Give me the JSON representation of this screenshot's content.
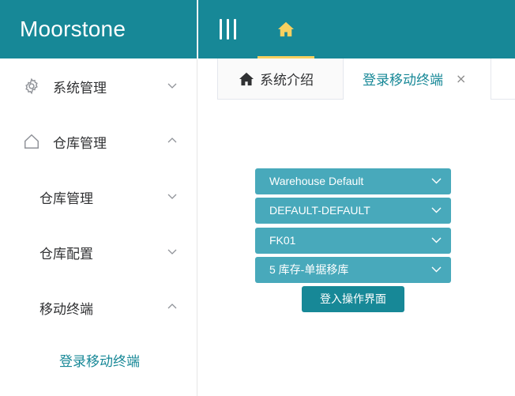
{
  "app": {
    "title": "Moorstone"
  },
  "colors": {
    "primary": "#178897",
    "select_bg": "#48a9bb",
    "home_underline": "#f7d060",
    "text": "#303133"
  },
  "header": {
    "menu_toggle_icon": "hamburger-icon",
    "home_icon": "home-icon"
  },
  "sidebar": {
    "items": [
      {
        "label": "系统管理",
        "icon": "gear-icon",
        "expanded": false
      },
      {
        "label": "仓库管理",
        "icon": "home-outline-icon",
        "expanded": true
      },
      {
        "label": "仓库管理",
        "expanded": false
      },
      {
        "label": "仓库配置",
        "expanded": false
      },
      {
        "label": "移动终端",
        "expanded": true
      },
      {
        "label": "登录移动终端",
        "active": true
      }
    ]
  },
  "tabs": [
    {
      "label": "系统介绍",
      "icon": "home-icon"
    },
    {
      "label": "登录移动终端",
      "active": true,
      "close": "×"
    }
  ],
  "form": {
    "selects": [
      {
        "value": "Warehouse Default"
      },
      {
        "value": "DEFAULT-DEFAULT"
      },
      {
        "value": "FK01"
      },
      {
        "value": "5 库存-单据移库"
      }
    ],
    "submit_label": "登入操作界面"
  }
}
